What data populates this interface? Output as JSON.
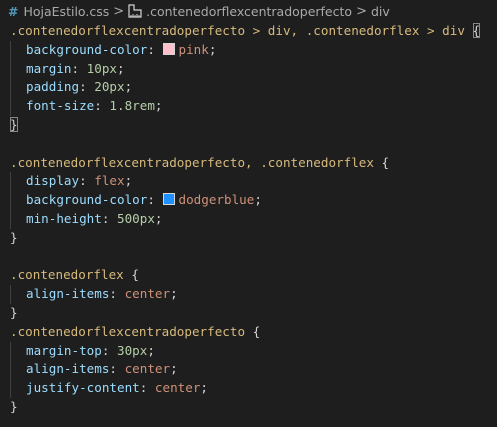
{
  "breadcrumb": {
    "file": "HojaEstilo.css",
    "symbol": ".contenedorflexcentradoperfecto",
    "leaf": "div",
    "hash": "#",
    "separator": ">"
  },
  "colors": {
    "selector": "#d7ba7d",
    "property": "#9cdcfe",
    "value": "#ce9178",
    "number": "#b5cea8",
    "pink": "#ffc0cb",
    "dodgerblue": "#1e90ff",
    "background": "#1e1e1e"
  },
  "code": {
    "b1": {
      "selector": ".contenedorflexcentradoperfecto > div, .contenedorflex > div",
      "open": "{",
      "decls": [
        {
          "prop": "background-color",
          "val": "pink"
        },
        {
          "prop": "margin",
          "val": "10px"
        },
        {
          "prop": "padding",
          "val": "20px"
        },
        {
          "prop": "font-size",
          "val": "1.8rem"
        }
      ],
      "close": "}"
    },
    "b2": {
      "selector": ".contenedorflexcentradoperfecto, .contenedorflex",
      "open": "{",
      "decls": [
        {
          "prop": "display",
          "val": "flex"
        },
        {
          "prop": "background-color",
          "val": "dodgerblue"
        },
        {
          "prop": "min-height",
          "val": "500px"
        }
      ],
      "close": "}"
    },
    "b3": {
      "selector": ".contenedorflex",
      "open": "{",
      "decls": [
        {
          "prop": "align-items",
          "val": "center"
        }
      ],
      "close": "}"
    },
    "b4": {
      "selector": ".contenedorflexcentradoperfecto",
      "open": "{",
      "decls": [
        {
          "prop": "margin-top",
          "val": "30px"
        },
        {
          "prop": "align-items",
          "val": "center"
        },
        {
          "prop": "justify-content",
          "val": "center"
        }
      ],
      "close": "}"
    }
  }
}
